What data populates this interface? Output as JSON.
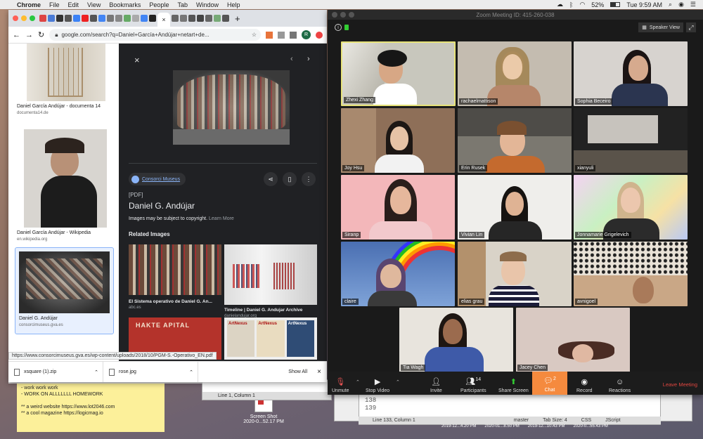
{
  "menubar": {
    "app": "Chrome",
    "items": [
      "File",
      "Edit",
      "View",
      "Bookmarks",
      "People",
      "Tab",
      "Window",
      "Help"
    ],
    "battery": "52%",
    "clock": "Tue 9:59 AM"
  },
  "chrome": {
    "url": "google.com/search?q=Daniel+García+Andújar+netart+de...",
    "avatar": "R",
    "results": [
      {
        "title": "Daniel García Andújar - documenta 14",
        "source": "documenta14.de"
      },
      {
        "title": "Daniel García Andújar - Wikipedia",
        "source": "en.wikipedia.org"
      },
      {
        "title": "Daniel G. Andújar",
        "source": "consorcimuseus.gva.es"
      }
    ],
    "panel": {
      "site": "Consorci Museus",
      "tag": "[PDF]",
      "title": "Daniel G. Andújar",
      "copyright": "Images may be subject to copyright.",
      "learn_more": "Learn More",
      "related_heading": "Related Images",
      "related": [
        {
          "title": "El Sistema operativo de Daniel G. An...",
          "source": "abc.es"
        },
        {
          "title": "Timeline | Daniel G. Andujar Archive",
          "source": "danielandujar.org"
        }
      ],
      "magazine": "ArtNexus",
      "ad_text": "HAKTE APITAL"
    },
    "status_url": "https://www.consorcimuseus.gva.es/wp-content/uploads/2018/10/PGM-S.-Operativo_EN.pdf",
    "downloads": [
      {
        "name": "xsquare (1).zip"
      },
      {
        "name": "rose.jpg"
      }
    ],
    "show_all": "Show All"
  },
  "zoom": {
    "title": "Zoom Meeting ID: 415-260-038",
    "view": "Speaker View",
    "participants": [
      "Zhexi Zhang",
      "rachaelmattison",
      "Sophia Beceiro",
      "Joy Hsu",
      "Erin Rusek",
      "xianyuli",
      "Siranp",
      "Vivian Lin",
      "Jonnamarie Grigelevich",
      "claire",
      "elias grau",
      "avnigoel",
      "Tia Wagh",
      "Jacey Chen"
    ],
    "toolbar": {
      "unmute": "Unmute",
      "stop_video": "Stop Video",
      "invite": "Invite",
      "participants": "Participants",
      "participants_count": "14",
      "share": "Share Screen",
      "chat": "Chat",
      "chat_badge": "2",
      "record": "Record",
      "reactions": "Reactions",
      "leave": "Leave Meeting"
    }
  },
  "sticky": {
    "lines": [
      "- work work work",
      "- WORK ON ALLLLLLL HOMEWORK",
      "",
      "** a weird website https://www.lot2046.com",
      "** a cool magazine https://logicmag.io"
    ]
  },
  "editor_lines": [
    "138",
    "139"
  ],
  "statusbars": {
    "a": "Line 1, Column 1",
    "b": "Line 1, Column 1",
    "c": "Line 133, Column 1",
    "branch": "master",
    "tab": "Tab Size: 4",
    "lang": "CSS",
    "script": "JScript"
  },
  "desktop": {
    "screenshot_label": "Screen Shot",
    "screenshot_date": "2020-0...52.17 PM",
    "dates": [
      "2019-12...4.20 PM",
      "2020-01...8.50 PM",
      "2019-12...10.43 PM",
      "2020-0...55.43 PM"
    ]
  },
  "colors": {
    "zoom_active": "#e7e37a",
    "chat_orange": "#f58a3e",
    "leave_red": "#e0463f"
  }
}
